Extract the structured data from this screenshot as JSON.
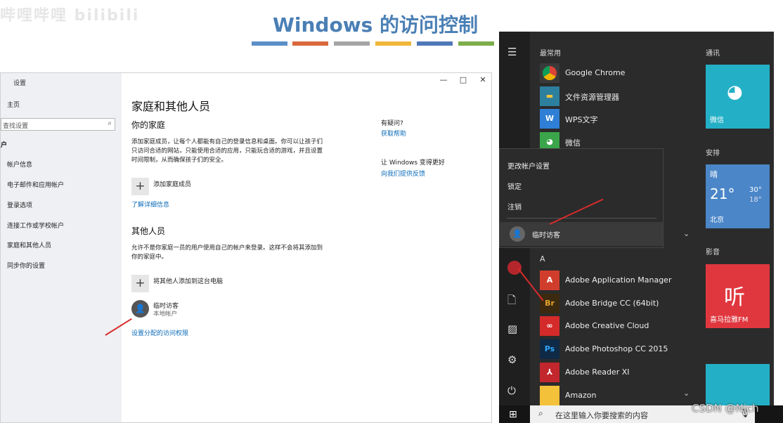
{
  "watermark_top": "哔哩哔哩 bilibili",
  "slide_title": "Windows 的访问控制",
  "stripe_colors": [
    "#5b8fc7",
    "#d9693c",
    "#a5a5a5",
    "#f0b73a",
    "#4f78b9",
    "#7dad4a"
  ],
  "settings": {
    "window_title": "设置",
    "minimize": "—",
    "maximize": "□",
    "close": "✕",
    "home": "主页",
    "search_placeholder": "查找设置",
    "section": "户",
    "nav": [
      "帐户信息",
      "电子邮件和应用帐户",
      "登录选项",
      "连接工作或学校帐户",
      "家庭和其他人员",
      "同步你的设置"
    ],
    "page_title": "家庭和其他人员",
    "family_heading": "你的家庭",
    "family_desc": "添加家庭成员，让每个人都能有自己的登录信息和桌面。你可以让孩子们只访问合适的网站，只能使用合适的应用，只能玩合适的游戏，并且设置时间限制，从而确保孩子们的安全。",
    "add_family": "添加家庭成员",
    "learn_more": "了解详细信息",
    "others_heading": "其他人员",
    "others_desc": "允许不是你家庭一员的用户使用自己的帐户来登录。这样不会将其添加到你的家庭中。",
    "add_other": "将其他人添加到这台电脑",
    "guest_name": "临时访客",
    "guest_type": "本地帐户",
    "assigned_access": "设置分配的访问权限",
    "help_title": "有疑问?",
    "help_link": "获取帮助",
    "feedback_title": "让 Windows 变得更好",
    "feedback_link": "向我们提供反馈"
  },
  "start_menu": {
    "most_used": "最常用",
    "most_used_apps": [
      "Google Chrome",
      "文件资源管理器",
      "WPS文字",
      "微信"
    ],
    "letter_a": "A",
    "a_apps": [
      "Adobe Application Manager",
      "Adobe Bridge CC (64bit)",
      "Adobe Creative Cloud",
      "Adobe Photoshop CC 2015",
      "Adobe Reader XI",
      "Amazon"
    ],
    "popup": {
      "change_settings": "更改帐户设置",
      "lock": "锁定",
      "sign_out": "注销",
      "guest": "临时访客"
    },
    "groups": {
      "comm": "通讯",
      "schedule": "安排",
      "media": "影音"
    },
    "tiles": {
      "wechat": "微信",
      "weather_cond": "晴",
      "weather_temp": "21°",
      "weather_high": "30°",
      "weather_low": "18°",
      "weather_city": "北京",
      "ximalaya": "喜马拉雅FM"
    },
    "search_bar": "在这里输入你要搜索的内容"
  },
  "watermark_bottom": "CSDN @Nich"
}
